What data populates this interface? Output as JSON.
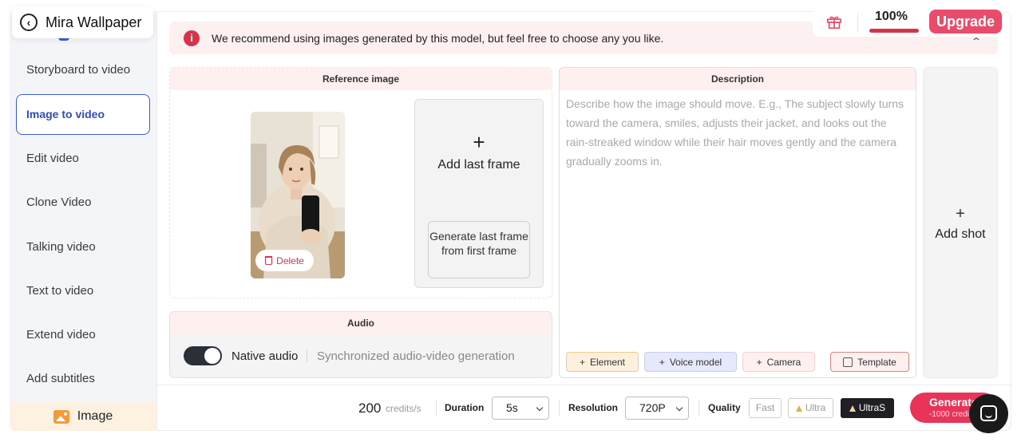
{
  "app": {
    "title": "Mira Wallpaper"
  },
  "sidebar": {
    "items": [
      {
        "label": "Storyboard to video"
      },
      {
        "label": "Image to video",
        "active": true
      },
      {
        "label": "Edit video"
      },
      {
        "label": "Clone Video"
      },
      {
        "label": "Talking video"
      },
      {
        "label": "Text to video"
      },
      {
        "label": "Extend video"
      },
      {
        "label": "Add subtitles"
      }
    ],
    "bottom_label": "Image"
  },
  "header": {
    "percent": "100%",
    "upgrade_label": "Upgrade"
  },
  "notice": {
    "text": "We recommend using images generated by this model, but feel free to choose any you like."
  },
  "reference": {
    "title": "Reference image",
    "delete_label": "Delete",
    "add_last_frame_label": "Add last frame",
    "generate_last_frame_label": "Generate last frame from first frame"
  },
  "audio": {
    "title": "Audio",
    "native_label": "Native audio",
    "native_enabled": true,
    "sync_label": "Synchronized audio-video generation"
  },
  "description": {
    "title": "Description",
    "placeholder": "Describe how the image should move. E.g., The subject slowly turns toward the camera, smiles, adjusts their jacket, and looks out the rain-streaked window while their hair moves gently and the camera gradually zooms in.",
    "chips": {
      "element": "Element",
      "voice_model": "Voice model",
      "camera": "Camera",
      "template": "Template"
    }
  },
  "add_shot": {
    "label": "Add shot"
  },
  "bottom": {
    "credits": "200",
    "credits_unit": "credits/s",
    "duration_label": "Duration",
    "duration_value": "5s",
    "resolution_label": "Resolution",
    "resolution_value": "720P",
    "quality_label": "Quality",
    "quality_options": {
      "fast": "Fast",
      "ultra": "Ultra",
      "ultras": "UltraS"
    },
    "quality_selected": "UltraS",
    "generate_label": "Generate",
    "generate_cost": "-1000 credits"
  },
  "colors": {
    "accent_blue": "#3e5bd8",
    "brand_pink": "#e94b6b",
    "notice_red": "#d9334a"
  }
}
